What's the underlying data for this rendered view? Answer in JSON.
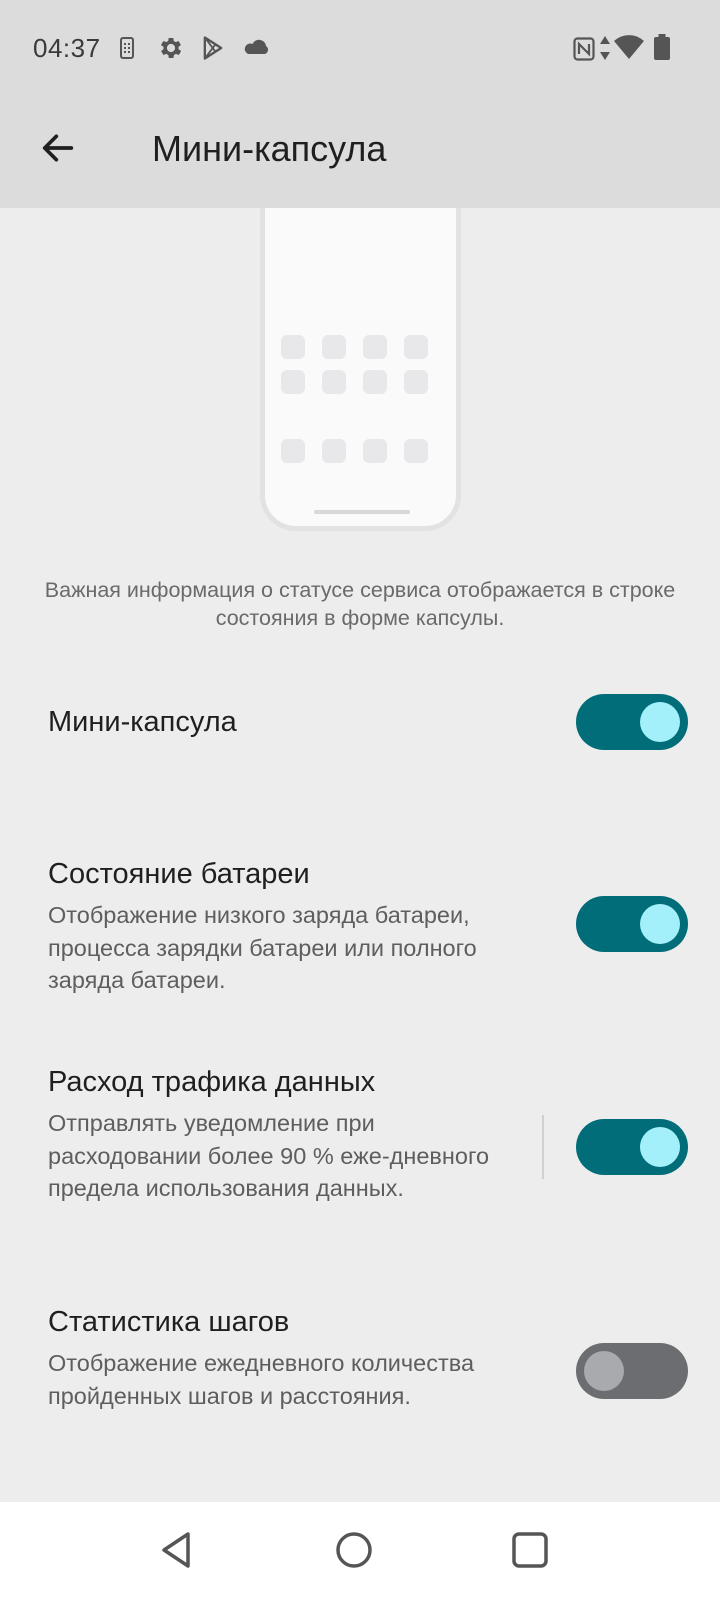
{
  "status_bar": {
    "time": "04:37",
    "left_icons": [
      "sim-card-icon",
      "settings-gear-icon",
      "play-store-icon",
      "cloud-icon"
    ],
    "right_icons": [
      "nfc-icon",
      "data-arrows-icon",
      "wifi-icon",
      "battery-icon"
    ]
  },
  "header": {
    "back_icon": "arrow-back-icon",
    "title": "Мини-капсула"
  },
  "illustration": {
    "description": "Важная информация о статусе сервиса отображается в строке состояния в форме капсулы."
  },
  "settings": {
    "mini_capsule": {
      "title": "Мини-капсула",
      "enabled": true
    },
    "battery_status": {
      "title": "Состояние батареи",
      "summary": "Отображение низкого заряда батареи, процесса зарядки батареи или полного заряда батареи.",
      "enabled": true
    },
    "data_usage": {
      "title": "Расход трафика данных",
      "summary": "Отправлять уведомление при расходовании более 90 % еже-дневного предела использования данных.",
      "enabled": true
    },
    "step_stats": {
      "title": "Статистика шагов",
      "summary": "Отображение ежедневного количества пройденных шагов и расстояния.",
      "enabled": false
    }
  },
  "nav_bar": {
    "buttons": [
      "back-triangle-icon",
      "home-circle-icon",
      "recents-square-icon"
    ]
  },
  "colors": {
    "toggle_on_track": "#006d78",
    "toggle_on_knob": "#a3f0fb",
    "toggle_off_track": "#6b6d70",
    "toggle_off_knob": "#a8aaad",
    "header_bg": "#dcdcdc",
    "page_bg": "#ededed"
  }
}
